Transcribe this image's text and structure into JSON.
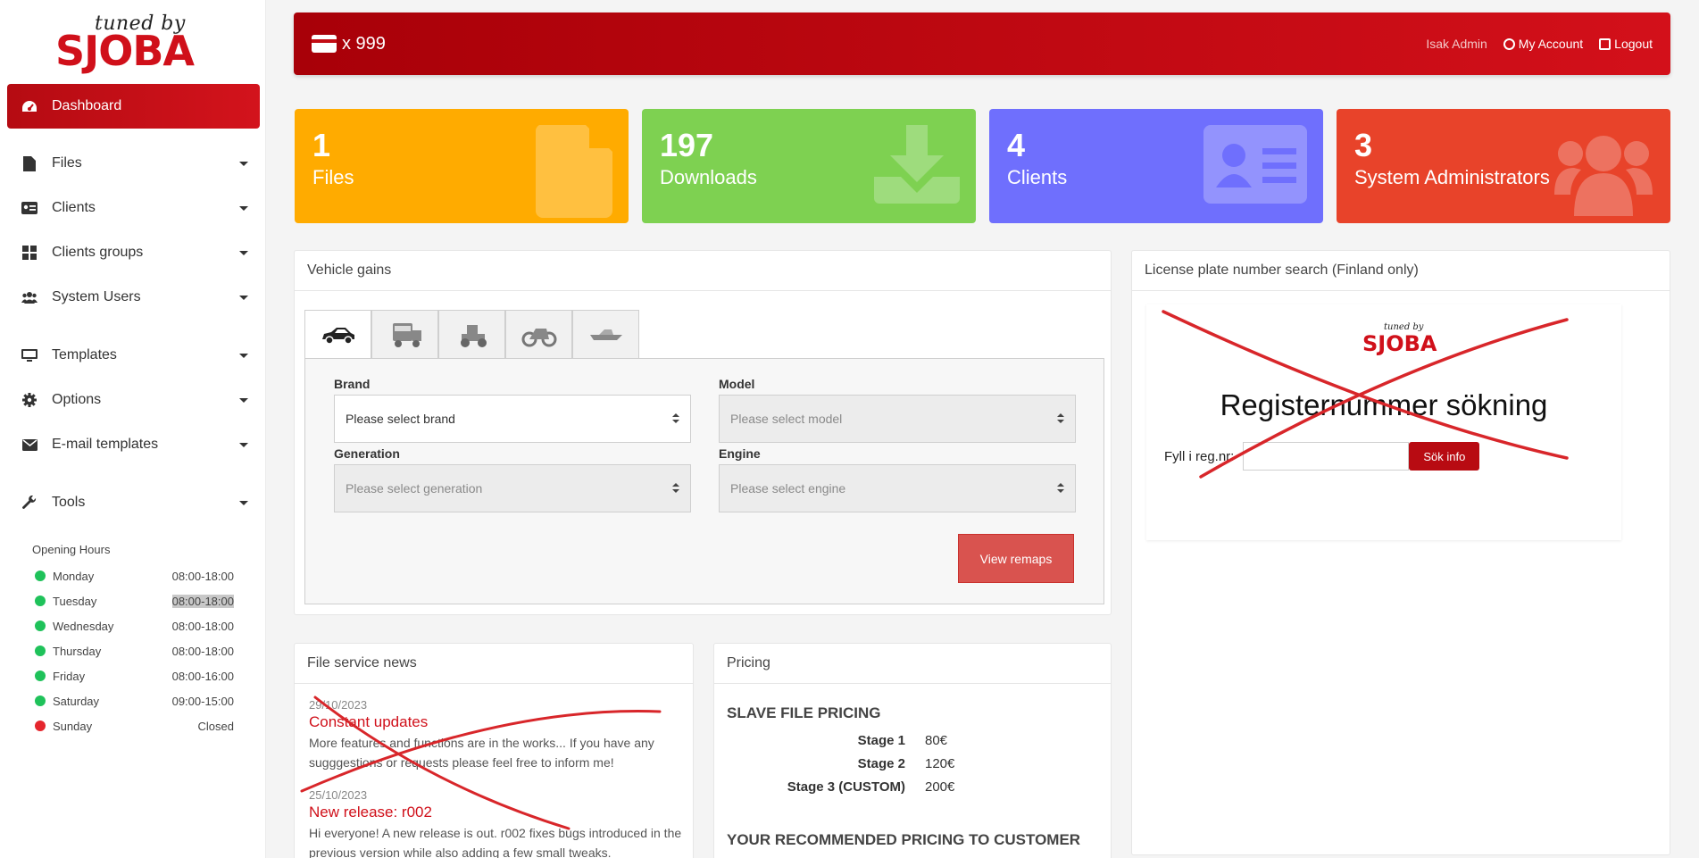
{
  "brand": {
    "logo_small": "tuned by",
    "logo_big": "SJOBA"
  },
  "sidebar": {
    "items": [
      {
        "label": "Dashboard",
        "icon": "dashboard-icon"
      },
      {
        "label": "Files",
        "icon": "file-icon"
      },
      {
        "label": "Clients",
        "icon": "id-card-icon"
      },
      {
        "label": "Clients groups",
        "icon": "grid-icon"
      },
      {
        "label": "System Users",
        "icon": "users-icon"
      },
      {
        "label": "Templates",
        "icon": "monitor-icon"
      },
      {
        "label": "Options",
        "icon": "gear-icon"
      },
      {
        "label": "E-mail templates",
        "icon": "envelope-icon"
      },
      {
        "label": "Tools",
        "icon": "wrench-icon"
      }
    ]
  },
  "opening_hours": {
    "title": "Opening Hours",
    "days": [
      {
        "day": "Monday",
        "time": "08:00-18:00",
        "status": "open"
      },
      {
        "day": "Tuesday",
        "time": "08:00-18:00",
        "status": "open"
      },
      {
        "day": "Wednesday",
        "time": "08:00-18:00",
        "status": "open"
      },
      {
        "day": "Thursday",
        "time": "08:00-18:00",
        "status": "open"
      },
      {
        "day": "Friday",
        "time": "08:00-16:00",
        "status": "open"
      },
      {
        "day": "Saturday",
        "time": "09:00-15:00",
        "status": "open"
      },
      {
        "day": "Sunday",
        "time": "Closed",
        "status": "closed"
      }
    ]
  },
  "topbar": {
    "credits": "x 999",
    "user": "Isak Admin",
    "my_account": "My Account",
    "logout": "Logout"
  },
  "stats": [
    {
      "value": "1",
      "label": "Files",
      "color": "#ffab00"
    },
    {
      "value": "197",
      "label": "Downloads",
      "color": "#7ed151"
    },
    {
      "value": "4",
      "label": "Clients",
      "color": "#6f6ffd"
    },
    {
      "value": "3",
      "label": "System Administrators",
      "color": "#e8432a"
    }
  ],
  "vehicle_gains": {
    "title": "Vehicle gains",
    "tabs": [
      "car-icon",
      "truck-icon",
      "tractor-icon",
      "motorcycle-icon",
      "boat-icon"
    ],
    "brand_label": "Brand",
    "brand_placeholder": "Please select brand",
    "model_label": "Model",
    "model_placeholder": "Please select model",
    "generation_label": "Generation",
    "generation_placeholder": "Please select generation",
    "engine_label": "Engine",
    "engine_placeholder": "Please select engine",
    "view_button": "View remaps"
  },
  "license_plate": {
    "title": "License plate number search (Finland only)",
    "logo_small": "tuned by",
    "logo_big": "SJOBA",
    "heading": "Registernummer sökning",
    "input_label": "Fyll i reg.nr:",
    "button": "Sök info"
  },
  "news": {
    "title": "File service news",
    "items": [
      {
        "date": "29/10/2023",
        "title": "Constant updates",
        "text": "More features and functions are in the works... If you have any sugggestions or requests please feel free to inform me!"
      },
      {
        "date": "25/10/2023",
        "title": "New release: r002",
        "text": "Hi everyone! A new release is out. r002 fixes bugs introduced in the previous version while also adding a few small tweaks."
      }
    ]
  },
  "pricing": {
    "title": "Pricing",
    "slave_heading": "SLAVE FILE PRICING",
    "rows": [
      {
        "stage": "Stage 1",
        "price": "80€"
      },
      {
        "stage": "Stage 2",
        "price": "120€"
      },
      {
        "stage": "Stage 3 (CUSTOM)",
        "price": "200€"
      }
    ],
    "recommended_heading": "YOUR RECOMMENDED PRICING TO CUSTOMER"
  }
}
